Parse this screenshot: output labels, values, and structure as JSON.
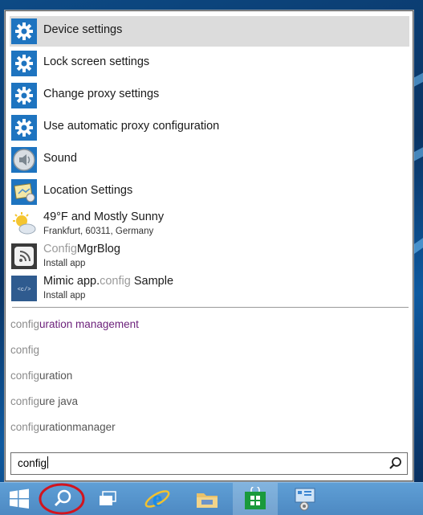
{
  "results": [
    {
      "title": "Device settings",
      "icon": "gear-icon",
      "selected": true
    },
    {
      "title": "Lock screen settings",
      "icon": "gear-icon"
    },
    {
      "title": "Change proxy settings",
      "icon": "gear-icon"
    },
    {
      "title": "Use automatic proxy configuration",
      "icon": "gear-icon"
    },
    {
      "title": "Sound",
      "icon": "speaker-icon"
    },
    {
      "title": "Location Settings",
      "icon": "location-settings-icon"
    },
    {
      "title": "49°F and Mostly Sunny",
      "subtitle": "Frankfurt, 60311, Germany",
      "icon": "weather-icon"
    },
    {
      "title_muted": "Config",
      "title_rest": "MgrBlog",
      "subtitle": "Install app",
      "icon": "rss-app-icon"
    },
    {
      "title_pre": "Mimic app.",
      "title_muted": "config",
      "title_post": " Sample",
      "subtitle": "Install app",
      "icon": "code-app-icon"
    }
  ],
  "suggestions": [
    {
      "prefix": "config",
      "rest": "uration management"
    },
    {
      "prefix": "config",
      "rest": ""
    },
    {
      "prefix": "config",
      "rest": "uration"
    },
    {
      "prefix": "config",
      "rest": "ure java"
    },
    {
      "prefix": "config",
      "rest": "urationmanager"
    }
  ],
  "search": {
    "value": "config",
    "icon": "search-icon"
  },
  "taskbar": {
    "items": [
      "windows-start-icon",
      "search-charm-icon",
      "task-view-icon",
      "internet-explorer-icon",
      "file-explorer-icon",
      "store-icon",
      "control-panel-icon"
    ]
  },
  "colors": {
    "accent": "#1e74c0",
    "selected_bg": "#dcdcdc",
    "suggestion_highlight": "#6b1f7a",
    "taskbar": "#5a98d0"
  }
}
